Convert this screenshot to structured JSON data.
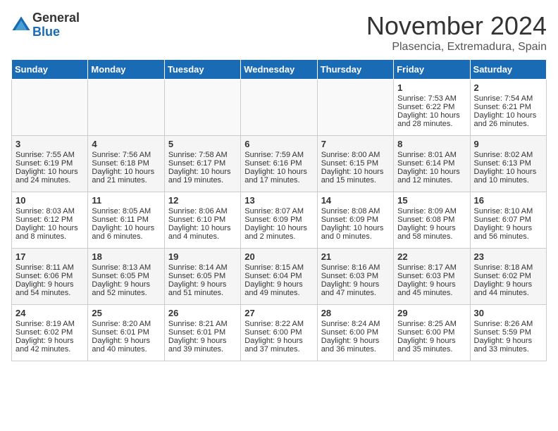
{
  "logo": {
    "general": "General",
    "blue": "Blue"
  },
  "header": {
    "title": "November 2024",
    "subtitle": "Plasencia, Extremadura, Spain"
  },
  "days_of_week": [
    "Sunday",
    "Monday",
    "Tuesday",
    "Wednesday",
    "Thursday",
    "Friday",
    "Saturday"
  ],
  "weeks": [
    [
      {
        "day": "",
        "content": ""
      },
      {
        "day": "",
        "content": ""
      },
      {
        "day": "",
        "content": ""
      },
      {
        "day": "",
        "content": ""
      },
      {
        "day": "",
        "content": ""
      },
      {
        "day": "1",
        "content": "Sunrise: 7:53 AM\nSunset: 6:22 PM\nDaylight: 10 hours and 28 minutes."
      },
      {
        "day": "2",
        "content": "Sunrise: 7:54 AM\nSunset: 6:21 PM\nDaylight: 10 hours and 26 minutes."
      }
    ],
    [
      {
        "day": "3",
        "content": "Sunrise: 7:55 AM\nSunset: 6:19 PM\nDaylight: 10 hours and 24 minutes."
      },
      {
        "day": "4",
        "content": "Sunrise: 7:56 AM\nSunset: 6:18 PM\nDaylight: 10 hours and 21 minutes."
      },
      {
        "day": "5",
        "content": "Sunrise: 7:58 AM\nSunset: 6:17 PM\nDaylight: 10 hours and 19 minutes."
      },
      {
        "day": "6",
        "content": "Sunrise: 7:59 AM\nSunset: 6:16 PM\nDaylight: 10 hours and 17 minutes."
      },
      {
        "day": "7",
        "content": "Sunrise: 8:00 AM\nSunset: 6:15 PM\nDaylight: 10 hours and 15 minutes."
      },
      {
        "day": "8",
        "content": "Sunrise: 8:01 AM\nSunset: 6:14 PM\nDaylight: 10 hours and 12 minutes."
      },
      {
        "day": "9",
        "content": "Sunrise: 8:02 AM\nSunset: 6:13 PM\nDaylight: 10 hours and 10 minutes."
      }
    ],
    [
      {
        "day": "10",
        "content": "Sunrise: 8:03 AM\nSunset: 6:12 PM\nDaylight: 10 hours and 8 minutes."
      },
      {
        "day": "11",
        "content": "Sunrise: 8:05 AM\nSunset: 6:11 PM\nDaylight: 10 hours and 6 minutes."
      },
      {
        "day": "12",
        "content": "Sunrise: 8:06 AM\nSunset: 6:10 PM\nDaylight: 10 hours and 4 minutes."
      },
      {
        "day": "13",
        "content": "Sunrise: 8:07 AM\nSunset: 6:09 PM\nDaylight: 10 hours and 2 minutes."
      },
      {
        "day": "14",
        "content": "Sunrise: 8:08 AM\nSunset: 6:09 PM\nDaylight: 10 hours and 0 minutes."
      },
      {
        "day": "15",
        "content": "Sunrise: 8:09 AM\nSunset: 6:08 PM\nDaylight: 9 hours and 58 minutes."
      },
      {
        "day": "16",
        "content": "Sunrise: 8:10 AM\nSunset: 6:07 PM\nDaylight: 9 hours and 56 minutes."
      }
    ],
    [
      {
        "day": "17",
        "content": "Sunrise: 8:11 AM\nSunset: 6:06 PM\nDaylight: 9 hours and 54 minutes."
      },
      {
        "day": "18",
        "content": "Sunrise: 8:13 AM\nSunset: 6:05 PM\nDaylight: 9 hours and 52 minutes."
      },
      {
        "day": "19",
        "content": "Sunrise: 8:14 AM\nSunset: 6:05 PM\nDaylight: 9 hours and 51 minutes."
      },
      {
        "day": "20",
        "content": "Sunrise: 8:15 AM\nSunset: 6:04 PM\nDaylight: 9 hours and 49 minutes."
      },
      {
        "day": "21",
        "content": "Sunrise: 8:16 AM\nSunset: 6:03 PM\nDaylight: 9 hours and 47 minutes."
      },
      {
        "day": "22",
        "content": "Sunrise: 8:17 AM\nSunset: 6:03 PM\nDaylight: 9 hours and 45 minutes."
      },
      {
        "day": "23",
        "content": "Sunrise: 8:18 AM\nSunset: 6:02 PM\nDaylight: 9 hours and 44 minutes."
      }
    ],
    [
      {
        "day": "24",
        "content": "Sunrise: 8:19 AM\nSunset: 6:02 PM\nDaylight: 9 hours and 42 minutes."
      },
      {
        "day": "25",
        "content": "Sunrise: 8:20 AM\nSunset: 6:01 PM\nDaylight: 9 hours and 40 minutes."
      },
      {
        "day": "26",
        "content": "Sunrise: 8:21 AM\nSunset: 6:01 PM\nDaylight: 9 hours and 39 minutes."
      },
      {
        "day": "27",
        "content": "Sunrise: 8:22 AM\nSunset: 6:00 PM\nDaylight: 9 hours and 37 minutes."
      },
      {
        "day": "28",
        "content": "Sunrise: 8:24 AM\nSunset: 6:00 PM\nDaylight: 9 hours and 36 minutes."
      },
      {
        "day": "29",
        "content": "Sunrise: 8:25 AM\nSunset: 6:00 PM\nDaylight: 9 hours and 35 minutes."
      },
      {
        "day": "30",
        "content": "Sunrise: 8:26 AM\nSunset: 5:59 PM\nDaylight: 9 hours and 33 minutes."
      }
    ]
  ]
}
